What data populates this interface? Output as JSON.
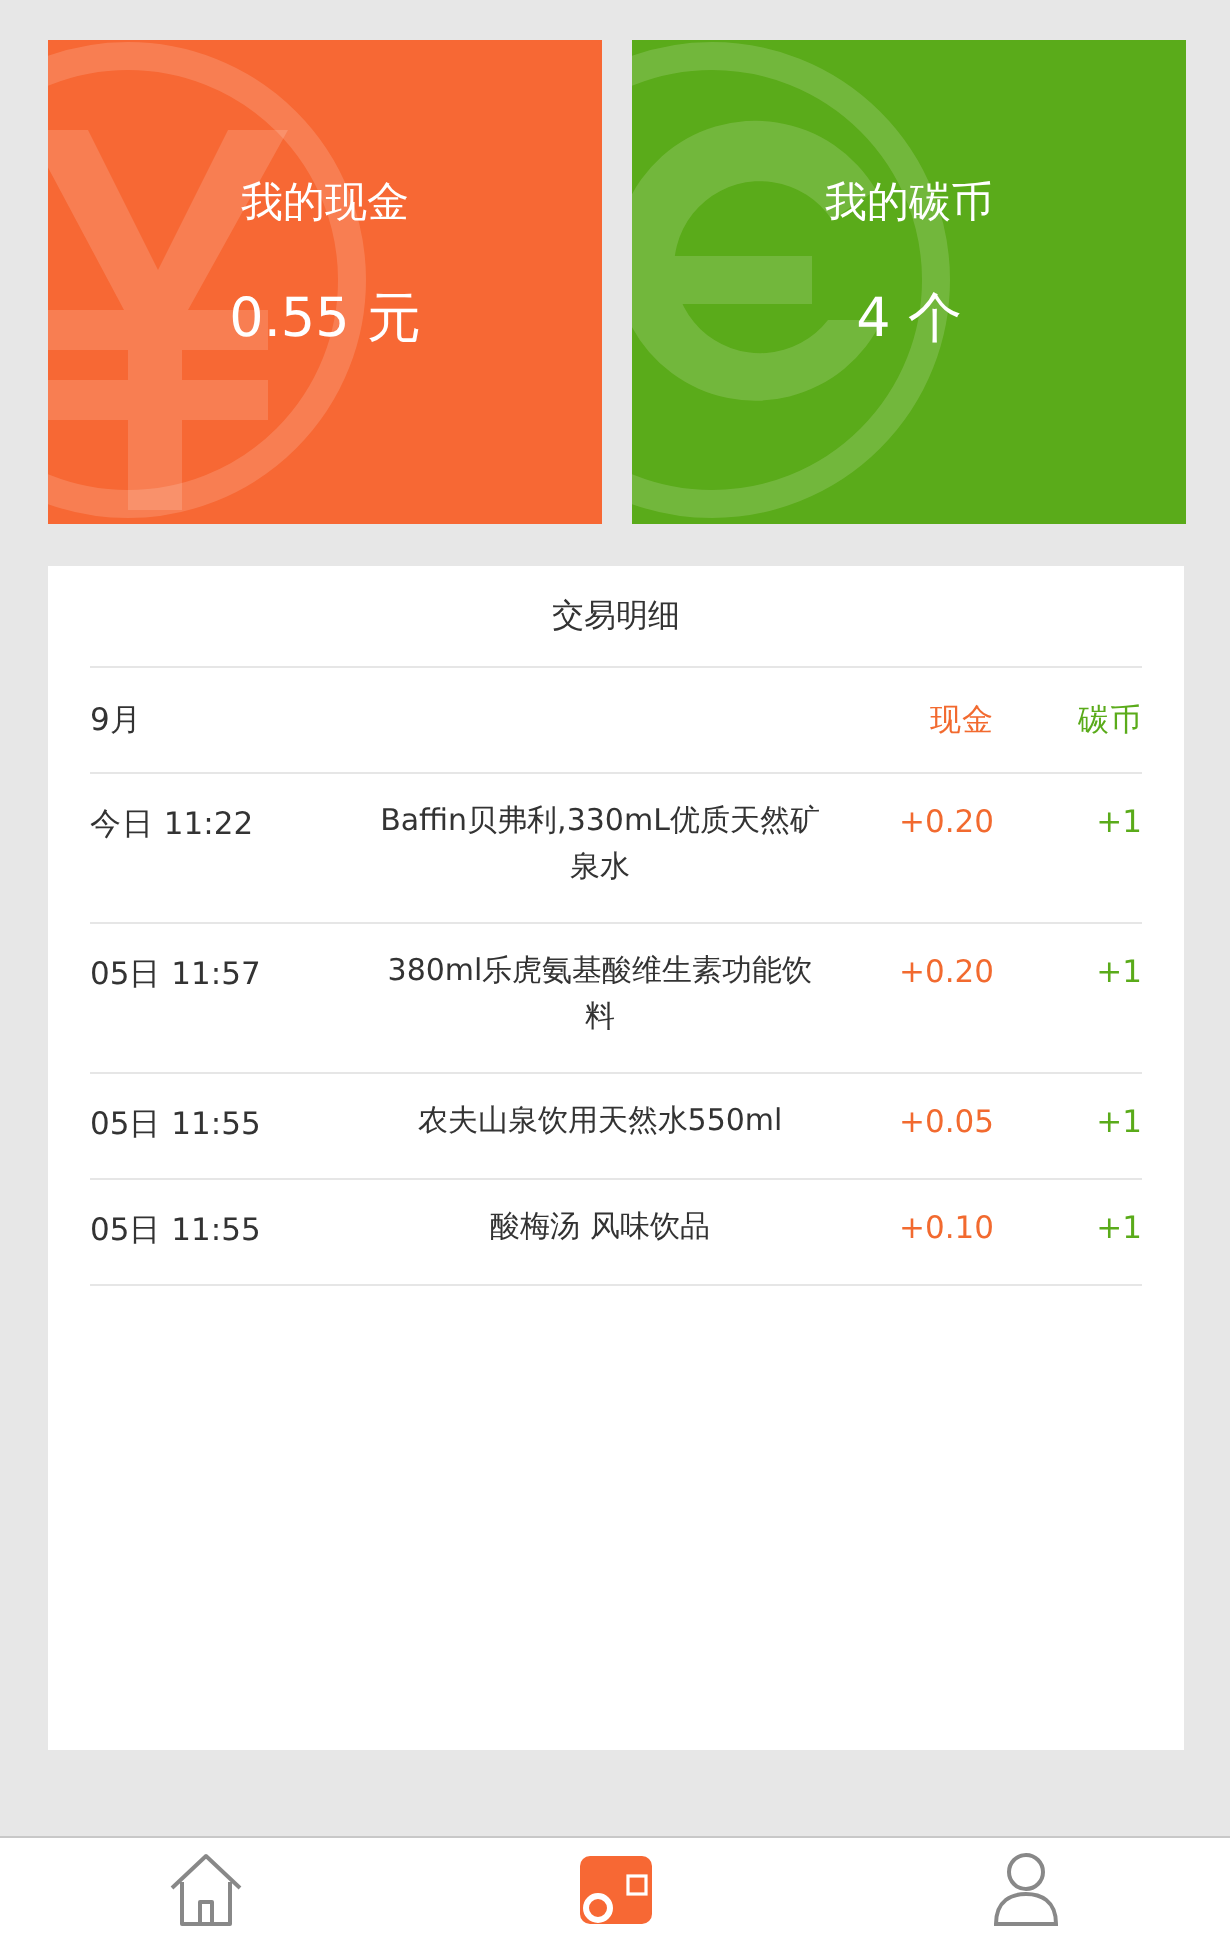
{
  "cards": [
    {
      "kind": "cash",
      "title": "我的现金",
      "value": "0.55 元"
    },
    {
      "kind": "coin",
      "title": "我的碳币",
      "value": "4 个"
    }
  ],
  "panel": {
    "title": "交易明细",
    "month": "9月",
    "cash_header": "现金",
    "coin_header": "碳币",
    "rows": [
      {
        "time": "今日 11:22",
        "item": "Baffin贝弗利,330mL优质天然矿泉水",
        "cash": "+0.20",
        "coin": "+1"
      },
      {
        "time": "05日 11:57",
        "item": "380ml乐虎氨基酸维生素功能饮料",
        "cash": "+0.20",
        "coin": "+1"
      },
      {
        "time": "05日 11:55",
        "item": "农夫山泉饮用天然水550ml",
        "cash": "+0.05",
        "coin": "+1"
      },
      {
        "time": "05日 11:55",
        "item": "酸梅汤 风味饮品",
        "cash": "+0.10",
        "coin": "+1"
      }
    ]
  },
  "tabs": [
    {
      "kind": "home",
      "selected": false
    },
    {
      "kind": "wallet",
      "selected": true
    },
    {
      "kind": "user",
      "selected": false
    }
  ]
}
